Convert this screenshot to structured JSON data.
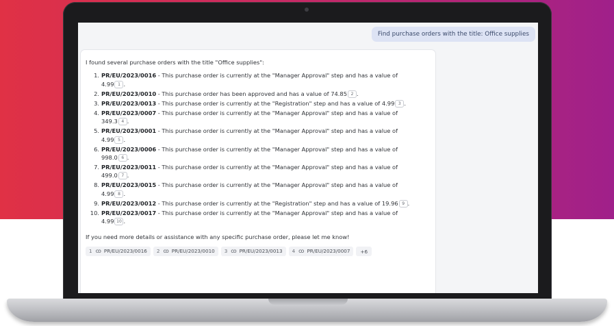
{
  "user_message": "Find purchase orders with the title: Office supplies",
  "assistant": {
    "intro": "I found several purchase orders with the title \"Office supplies\":",
    "items": [
      {
        "num": "1.",
        "po": "PR/EU/2023/0016",
        "line": " - This purchase order is currently at the \"Manager Approval\" step and has a value of",
        "wrap": "4.99",
        "cite": "1",
        "end": "."
      },
      {
        "num": "2.",
        "po": "PR/EU/2023/0010",
        "line": " - This purchase order has been approved and has a value of 74.85",
        "wrap": "",
        "cite": "2",
        "end": "."
      },
      {
        "num": "3.",
        "po": "PR/EU/2023/0013",
        "line": " - This purchase order is currently at the \"Registration\" step and has a value of 4.99",
        "wrap": "",
        "cite": "3",
        "end": "."
      },
      {
        "num": "4.",
        "po": "PR/EU/2023/0007",
        "line": " - This purchase order is currently at the \"Manager Approval\" step and has a value of",
        "wrap": "349.3",
        "cite": "4",
        "end": "."
      },
      {
        "num": "5.",
        "po": "PR/EU/2023/0001",
        "line": " - This purchase order is currently at the \"Manager Approval\" step and has a value of",
        "wrap": "4.99",
        "cite": "5",
        "end": "."
      },
      {
        "num": "6.",
        "po": "PR/EU/2023/0006",
        "line": " - This purchase order is currently at the \"Manager Approval\" step and has a value of",
        "wrap": "998.0",
        "cite": "6",
        "end": "."
      },
      {
        "num": "7.",
        "po": "PR/EU/2023/0011",
        "line": " - This purchase order is currently at the \"Manager Approval\" step and has a value of",
        "wrap": "499.0",
        "cite": "7",
        "end": "."
      },
      {
        "num": "8.",
        "po": "PR/EU/2023/0015",
        "line": " - This purchase order is currently at the \"Manager Approval\" step and has a value of",
        "wrap": "4.99",
        "cite": "8",
        "end": "."
      },
      {
        "num": "9.",
        "po": "PR/EU/2023/0012",
        "line": " - This purchase order is currently at the \"Registration\" step and has a value of 19.96",
        "wrap": "",
        "cite": "9",
        "end": "."
      },
      {
        "num": "10.",
        "po": "PR/EU/2023/0017",
        "line": " - This purchase order is currently at the \"Manager Approval\" step and has a value of",
        "wrap": "4.99",
        "cite": "10",
        "end": "."
      }
    ],
    "outro": "If you need more details or assistance with any specific purchase order, please let me know!",
    "references": [
      {
        "index": "1",
        "label": "PR/EU/2023/0016"
      },
      {
        "index": "2",
        "label": "PR/EU/2023/0010"
      },
      {
        "index": "3",
        "label": "PR/EU/2023/0013"
      },
      {
        "index": "4",
        "label": "PR/EU/2023/0007"
      }
    ],
    "more_label": "+6",
    "link_icon": "link-chain-icon"
  },
  "colors": {
    "gradient_left": "#e03145",
    "gradient_right": "#a0208a",
    "user_bubble": "#dde3f4"
  }
}
